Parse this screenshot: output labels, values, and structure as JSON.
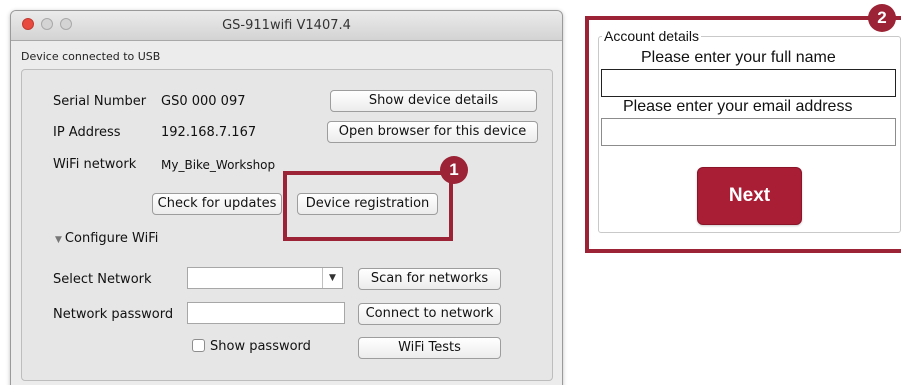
{
  "window": {
    "title": "GS-911wifi V1407.4",
    "status": "Device connected to USB"
  },
  "device": {
    "serial_label": "Serial Number",
    "serial_value": "GS0 000 097",
    "ip_label": "IP Address",
    "ip_value": "192.168.7.167",
    "wifi_label": "WiFi network",
    "wifi_value": "My_Bike_Workshop"
  },
  "buttons": {
    "show_details": "Show device details",
    "open_browser": "Open browser for this device",
    "check_updates": "Check for updates",
    "device_registration": "Device registration",
    "scan_networks": "Scan for networks",
    "connect_network": "Connect to network",
    "wifi_tests": "WiFi Tests"
  },
  "configure": {
    "heading": "Configure WiFi",
    "select_network_label": "Select Network",
    "select_network_value": "",
    "password_label": "Network password",
    "password_value": "",
    "show_password_label": "Show password",
    "show_password_checked": false
  },
  "callouts": {
    "badge_1": "1",
    "badge_2": "2",
    "color": "#9b2335"
  },
  "account": {
    "legend": "Account details",
    "name_prompt": "Please enter your full name",
    "name_value": "",
    "email_prompt": "Please enter your email address",
    "email_value": "",
    "next_label": "Next",
    "next_color": "#a91d35"
  }
}
